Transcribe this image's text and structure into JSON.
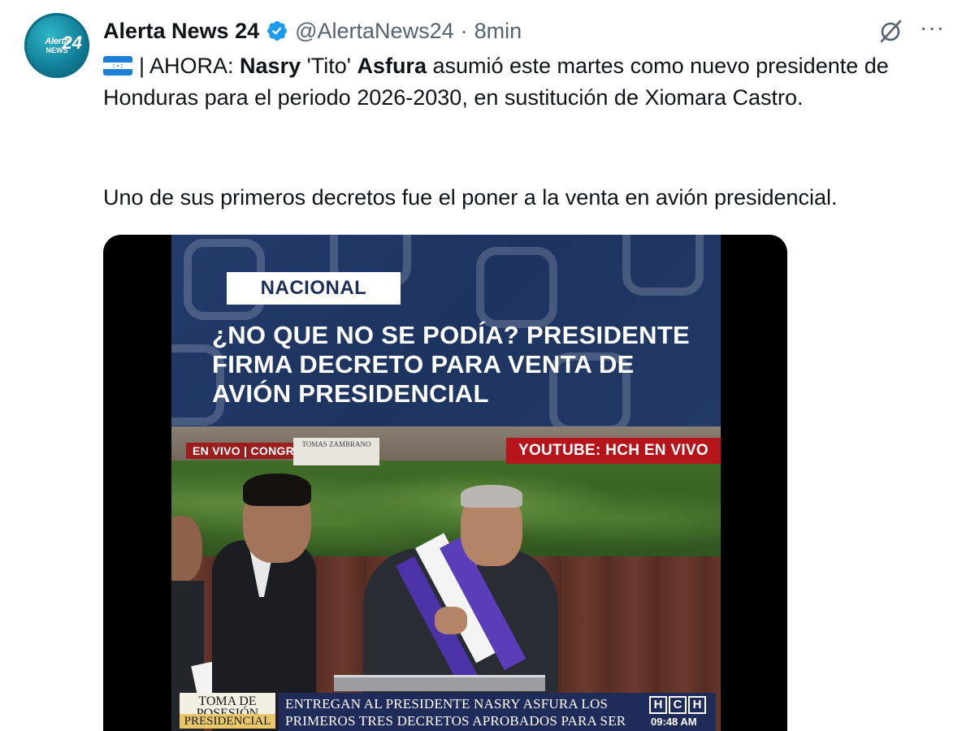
{
  "author": {
    "name": "Alerta News 24",
    "handle": "@AlertaNews24",
    "separator": "·",
    "time": "8min",
    "avatar_text_top": "Alerta",
    "avatar_text_bottom": "NEWS",
    "avatar_text_number": "24"
  },
  "actions": {
    "grok_icon": "grok-icon",
    "more_label": "···"
  },
  "tweet": {
    "lead": "| AHORA: ",
    "name1": "Nasry",
    "name_mid": " 'Tito' ",
    "name2": "Asfura",
    "rest": " asumió este martes como nuevo presidente de Honduras para el periodo 2026-2030, en sustitución de Xiomara Castro.",
    "second_paragraph": "Uno de sus primeros decretos fue el poner a la venta en avión presidencial."
  },
  "media": {
    "tag": "NACIONAL",
    "headline": "¿NO QUE NO SE PODÍA? PRESIDENTE FIRMA DECRETO PARA VENTA DE AVIÓN PRESIDENCIAL",
    "live_left": "EN VIVO | CONGRESO",
    "nameplate": "TOMAS ZAMBRANO",
    "live_right": "YOUTUBE: HCH EN VIVO",
    "lower_left_top": "TOMA DE POSESIÓN",
    "lower_left_bottom": "PRESIDENCIAL",
    "lower_mid": "ENTREGAN AL PRESIDENTE NASRY ASFURA LOS PRIMEROS TRES DECRETOS APROBADOS PARA SER FIRMADOS Y SANCIONADOS",
    "logo_h1": "H",
    "logo_c": "C",
    "logo_h2": "H",
    "clock": "09:48 AM"
  },
  "colors": {
    "accent_blue": "#1d9bf0",
    "text_secondary": "#536471",
    "banner_navy": "#1d3360",
    "live_red": "#b5141a"
  }
}
